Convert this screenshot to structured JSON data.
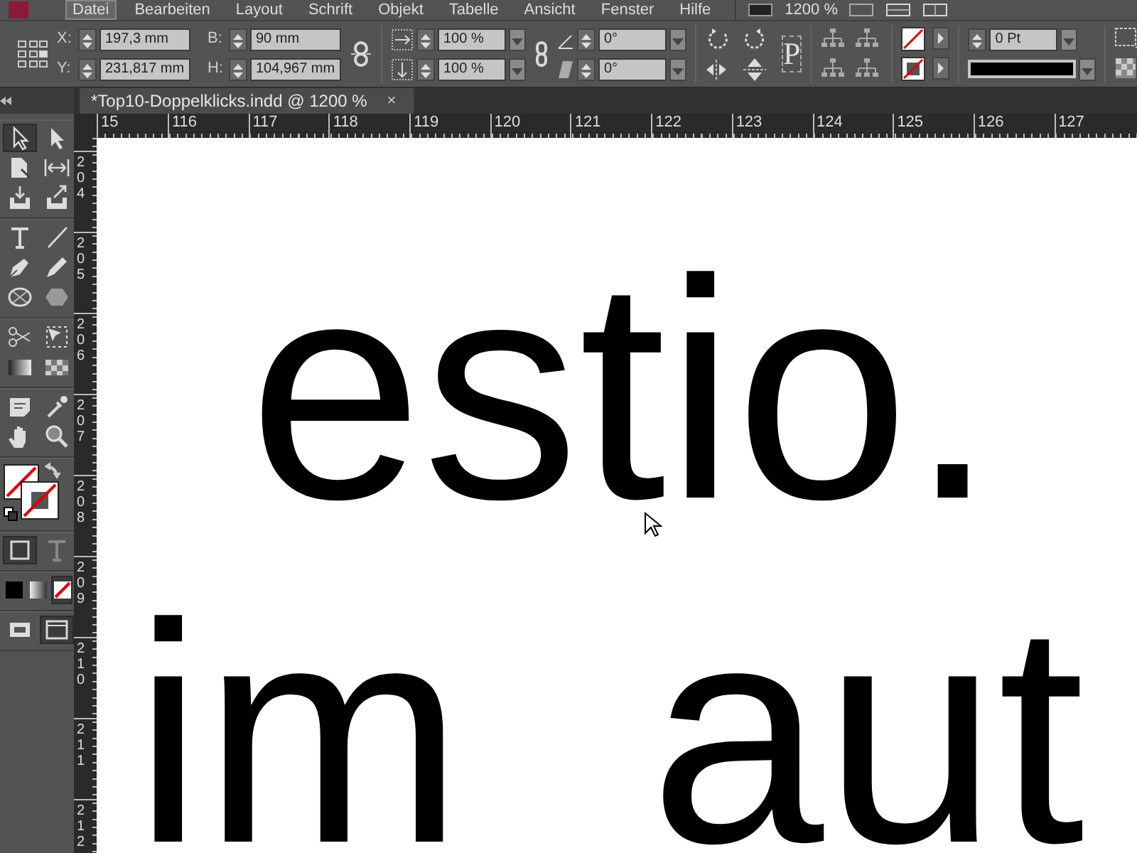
{
  "menu_bar": {
    "items": [
      {
        "label": "Datei",
        "selected": true
      },
      {
        "label": "Bearbeiten",
        "selected": false
      },
      {
        "label": "Layout",
        "selected": false
      },
      {
        "label": "Schrift",
        "selected": false
      },
      {
        "label": "Objekt",
        "selected": false
      },
      {
        "label": "Tabelle",
        "selected": false
      },
      {
        "label": "Ansicht",
        "selected": false
      },
      {
        "label": "Fenster",
        "selected": false
      },
      {
        "label": "Hilfe",
        "selected": false
      }
    ],
    "zoom": "1200 %"
  },
  "control_panel": {
    "position_fields": [
      {
        "label": "X:",
        "value": "197,3 mm"
      },
      {
        "label": "Y:",
        "value": "231,817 mm"
      }
    ],
    "size_fields": [
      {
        "label": "B:",
        "value": "90 mm"
      },
      {
        "label": "H:",
        "value": "104,967 mm"
      }
    ],
    "scale_fields": [
      "100 %",
      "100 %"
    ],
    "angle_fields": [
      "0°",
      "0°"
    ],
    "content_glyph": "P",
    "stroke_weight": "0 Pt"
  },
  "document_tab": {
    "title": "*Top10-Doppelklicks.indd @ 1200 %",
    "close": "×"
  },
  "horizontal_ruler": [
    "15",
    "116",
    "117",
    "118",
    "119",
    "120",
    "121",
    "122",
    "123",
    "124",
    "125",
    "126",
    "127"
  ],
  "vertical_ruler": [
    "204",
    "205",
    "206",
    "207",
    "208",
    "209",
    "210",
    "211",
    "212"
  ],
  "tool_groups": [
    [
      {
        "kind": "selection",
        "selected": true
      },
      {
        "kind": "direct-selection",
        "selected": false
      },
      {
        "kind": "page",
        "selected": false
      },
      {
        "kind": "gap",
        "selected": false
      },
      {
        "kind": "content-collector",
        "selected": false
      },
      {
        "kind": "content-placer",
        "selected": false
      }
    ],
    [
      {
        "kind": "type",
        "selected": false
      },
      {
        "kind": "line",
        "selected": false
      },
      {
        "kind": "pen",
        "selected": false
      },
      {
        "kind": "pencil",
        "selected": false
      },
      {
        "kind": "ellipse-frame",
        "selected": false
      },
      {
        "kind": "polygon",
        "selected": false
      }
    ],
    [
      {
        "kind": "scissors",
        "selected": false
      },
      {
        "kind": "free-transform",
        "selected": false
      },
      {
        "kind": "gradient-swatch",
        "selected": false
      },
      {
        "kind": "gradient-feather",
        "selected": false
      }
    ],
    [
      {
        "kind": "note",
        "selected": false
      },
      {
        "kind": "eyedropper",
        "selected": false
      },
      {
        "kind": "hand",
        "selected": false
      },
      {
        "kind": "zoom",
        "selected": false
      }
    ],
    [
      {
        "kind": "fill-stroke",
        "selected": false
      }
    ],
    [
      {
        "kind": "container-formatting",
        "selected": true
      },
      {
        "kind": "text-formatting",
        "selected": false
      }
    ],
    [
      {
        "kind": "apply-color",
        "selected": false
      },
      {
        "kind": "apply-gradient",
        "selected": false
      },
      {
        "kind": "apply-none",
        "selected": true
      }
    ],
    [
      {
        "kind": "normal-view",
        "selected": false
      },
      {
        "kind": "screen-mode",
        "selected": true
      }
    ]
  ],
  "canvas": {
    "lines": [
      "estio.",
      "im aut"
    ]
  }
}
